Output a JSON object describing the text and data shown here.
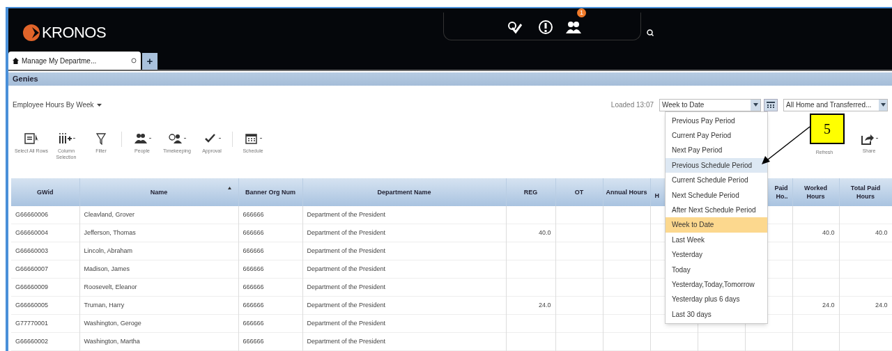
{
  "header": {
    "logo": "KRONOS",
    "notification_badge": "1"
  },
  "tabs": [
    {
      "label": "Manage My Departme...",
      "selected": true
    }
  ],
  "add_tab": "+",
  "section_title": "Genies",
  "genie": {
    "title": "Employee Hours By Week",
    "loaded": "Loaded 13:07",
    "timeframe": "Week to Date",
    "hyperfind": "All Home and Transferred..."
  },
  "toolbar": [
    {
      "kind": "select",
      "label": "Select All Rows"
    },
    {
      "kind": "columns",
      "label": "Column Selection"
    },
    {
      "kind": "filter",
      "label": "Filter"
    },
    {
      "kind": "people",
      "label": "People"
    },
    {
      "kind": "timekeeping",
      "label": "Timekeeping"
    },
    {
      "kind": "approval",
      "label": "Approval"
    },
    {
      "kind": "schedule",
      "label": "Schedule"
    }
  ],
  "toolbar_right": [
    {
      "kind": "refresh",
      "label": "Refresh"
    },
    {
      "kind": "share",
      "label": "Share"
    }
  ],
  "timeframe_menu": [
    {
      "label": "Previous Pay Period",
      "selected": false,
      "hovered": false
    },
    {
      "label": "Current Pay Period",
      "selected": false,
      "hovered": false
    },
    {
      "label": "Next Pay Period",
      "selected": false,
      "hovered": false
    },
    {
      "label": "Previous Schedule Period",
      "selected": false,
      "hovered": true
    },
    {
      "label": "Current Schedule Period",
      "selected": false,
      "hovered": false
    },
    {
      "label": "Next Schedule Period",
      "selected": false,
      "hovered": false
    },
    {
      "label": "After Next Schedule Period",
      "selected": false,
      "hovered": false
    },
    {
      "label": "Week to Date",
      "selected": true,
      "hovered": false
    },
    {
      "label": "Last Week",
      "selected": false,
      "hovered": false
    },
    {
      "label": "Yesterday",
      "selected": false,
      "hovered": false
    },
    {
      "label": "Today",
      "selected": false,
      "hovered": false
    },
    {
      "label": "Yesterday,Today,Tomorrow",
      "selected": false,
      "hovered": false
    },
    {
      "label": "Yesterday plus 6 days",
      "selected": false,
      "hovered": false
    },
    {
      "label": "Last 30 days",
      "selected": false,
      "hovered": false
    }
  ],
  "callout": "5",
  "table": {
    "columns": [
      {
        "label": "GWid"
      },
      {
        "label": "Name",
        "sorted": true
      },
      {
        "label": "Banner Org Num"
      },
      {
        "label": "Department Name"
      },
      {
        "label": "REG"
      },
      {
        "label": "OT"
      },
      {
        "label": "Annual Hours"
      },
      {
        "label": "H"
      },
      {},
      {
        "label": "Paid Ho.."
      },
      {
        "label": "Worked Hours"
      },
      {
        "label": "Total Paid Hours"
      }
    ],
    "rows": [
      [
        "G66660006",
        "Cleavland, Grover",
        "666666",
        "Department of the President",
        "",
        "",
        "",
        "",
        "",
        "",
        "",
        ""
      ],
      [
        "G66660004",
        "Jefferson, Thomas",
        "666666",
        "Department of the President",
        "40.0",
        "",
        "",
        "",
        "",
        "",
        "40.0",
        "40.0"
      ],
      [
        "G66660003",
        "Lincoln, Abraham",
        "666666",
        "Department of the President",
        "",
        "",
        "",
        "",
        "",
        "",
        "",
        ""
      ],
      [
        "G66660007",
        "Madison, James",
        "666666",
        "Department of the President",
        "",
        "",
        "",
        "",
        "",
        "",
        "",
        ""
      ],
      [
        "G66660009",
        "Roosevelt, Eleanor",
        "666666",
        "Department of the President",
        "",
        "",
        "",
        "",
        "",
        "",
        "",
        ""
      ],
      [
        "G66660005",
        "Truman, Harry",
        "666666",
        "Department of the President",
        "24.0",
        "",
        "",
        "",
        "",
        "",
        "24.0",
        "24.0"
      ],
      [
        "G77770001",
        "Washington, Geroge",
        "666666",
        "Department of the President",
        "",
        "",
        "",
        "",
        "",
        "",
        "",
        ""
      ],
      [
        "G66660002",
        "Washington, Martha",
        "666666",
        "Department of the President",
        "",
        "",
        "",
        "",
        "",
        "",
        "",
        ""
      ]
    ]
  }
}
